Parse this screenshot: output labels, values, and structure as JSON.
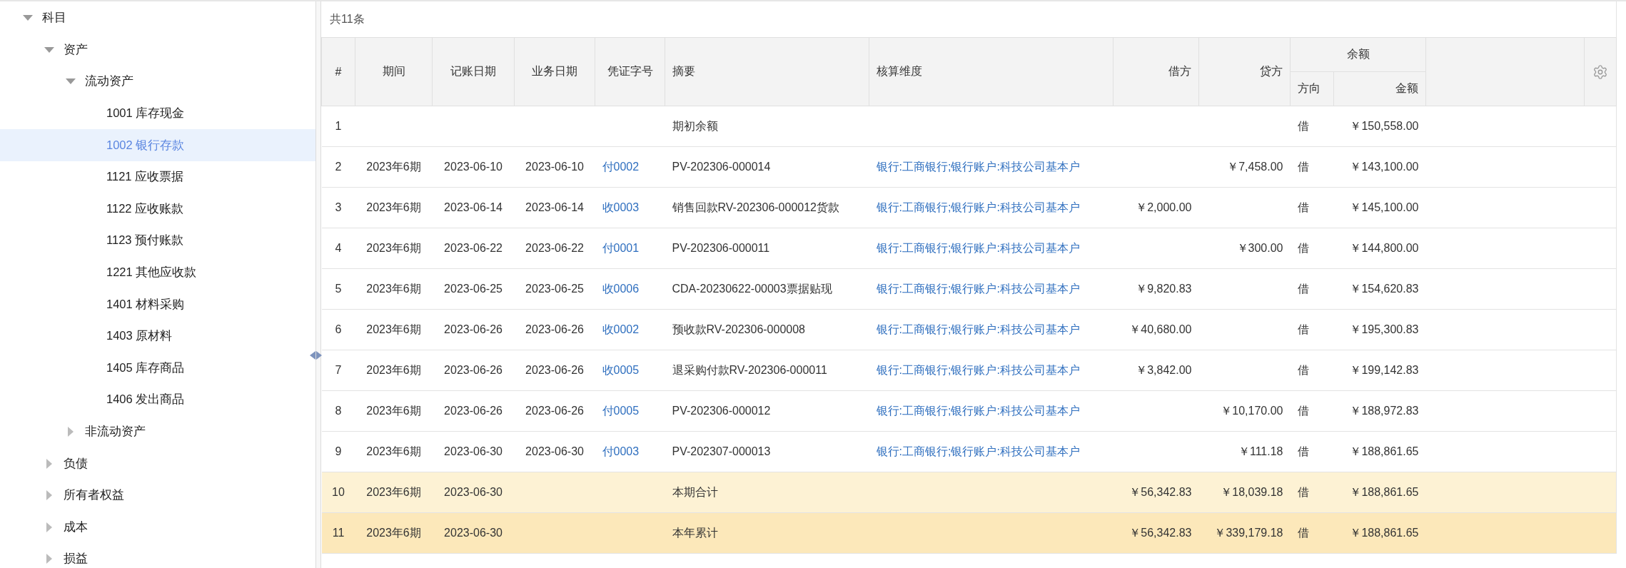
{
  "sidebar": {
    "tree": [
      {
        "label": "科目",
        "expanded": true,
        "selected": false,
        "children": [
          {
            "label": "资产",
            "expanded": true,
            "selected": false,
            "children": [
              {
                "label": "流动资产",
                "expanded": true,
                "selected": false,
                "children": [
                  {
                    "label": "1001 库存现金",
                    "selected": false
                  },
                  {
                    "label": "1002 银行存款",
                    "selected": true
                  },
                  {
                    "label": "1121 应收票据",
                    "selected": false
                  },
                  {
                    "label": "1122 应收账款",
                    "selected": false
                  },
                  {
                    "label": "1123 预付账款",
                    "selected": false
                  },
                  {
                    "label": "1221 其他应收款",
                    "selected": false
                  },
                  {
                    "label": "1401 材料采购",
                    "selected": false
                  },
                  {
                    "label": "1403 原材料",
                    "selected": false
                  },
                  {
                    "label": "1405 库存商品",
                    "selected": false
                  },
                  {
                    "label": "1406 发出商品",
                    "selected": false
                  }
                ]
              },
              {
                "label": "非流动资产",
                "expanded": false,
                "selected": false
              }
            ]
          },
          {
            "label": "负债",
            "expanded": false,
            "selected": false
          },
          {
            "label": "所有者权益",
            "expanded": false,
            "selected": false
          },
          {
            "label": "成本",
            "expanded": false,
            "selected": false
          },
          {
            "label": "损益",
            "expanded": false,
            "selected": false
          }
        ]
      }
    ]
  },
  "ledger": {
    "count_label": "共11条",
    "columns": [
      "#",
      "期间",
      "记账日期",
      "业务日期",
      "凭证字号",
      "摘要",
      "核算维度",
      "借方",
      "贷方"
    ],
    "balance_group": {
      "label": "余额",
      "columns": [
        "方向",
        "金额"
      ]
    },
    "rows": [
      {
        "kind": "normal",
        "no": "1",
        "summary": "期初余额",
        "direction": "借",
        "balance": "￥150,558.00"
      },
      {
        "kind": "normal",
        "no": "2",
        "period": "2023年6期",
        "post_date": "2023-06-10",
        "biz_date": "2023-06-10",
        "voucher": "付0002",
        "summary": "PV-202306-000014",
        "dimension": "银行:工商银行;银行账户:科技公司基本户",
        "credit": "￥7,458.00",
        "direction": "借",
        "balance": "￥143,100.00"
      },
      {
        "kind": "normal",
        "no": "3",
        "period": "2023年6期",
        "post_date": "2023-06-14",
        "biz_date": "2023-06-14",
        "voucher": "收0003",
        "summary": "销售回款RV-202306-000012货款",
        "dimension": "银行:工商银行;银行账户:科技公司基本户",
        "debit": "￥2,000.00",
        "direction": "借",
        "balance": "￥145,100.00"
      },
      {
        "kind": "normal",
        "no": "4",
        "period": "2023年6期",
        "post_date": "2023-06-22",
        "biz_date": "2023-06-22",
        "voucher": "付0001",
        "summary": "PV-202306-000011",
        "dimension": "银行:工商银行;银行账户:科技公司基本户",
        "credit": "￥300.00",
        "direction": "借",
        "balance": "￥144,800.00"
      },
      {
        "kind": "normal",
        "no": "5",
        "period": "2023年6期",
        "post_date": "2023-06-25",
        "biz_date": "2023-06-25",
        "voucher": "收0006",
        "summary": "CDA-20230622-00003票据贴现",
        "dimension": "银行:工商银行;银行账户:科技公司基本户",
        "debit": "￥9,820.83",
        "direction": "借",
        "balance": "￥154,620.83"
      },
      {
        "kind": "normal",
        "no": "6",
        "period": "2023年6期",
        "post_date": "2023-06-26",
        "biz_date": "2023-06-26",
        "voucher": "收0002",
        "summary": "预收款RV-202306-000008",
        "dimension": "银行:工商银行;银行账户:科技公司基本户",
        "debit": "￥40,680.00",
        "direction": "借",
        "balance": "￥195,300.83"
      },
      {
        "kind": "normal",
        "no": "7",
        "period": "2023年6期",
        "post_date": "2023-06-26",
        "biz_date": "2023-06-26",
        "voucher": "收0005",
        "summary": "退采购付款RV-202306-000011",
        "dimension": "银行:工商银行;银行账户:科技公司基本户",
        "debit": "￥3,842.00",
        "direction": "借",
        "balance": "￥199,142.83"
      },
      {
        "kind": "normal",
        "no": "8",
        "period": "2023年6期",
        "post_date": "2023-06-26",
        "biz_date": "2023-06-26",
        "voucher": "付0005",
        "summary": "PV-202306-000012",
        "dimension": "银行:工商银行;银行账户:科技公司基本户",
        "credit": "￥10,170.00",
        "direction": "借",
        "balance": "￥188,972.83"
      },
      {
        "kind": "normal",
        "no": "9",
        "period": "2023年6期",
        "post_date": "2023-06-30",
        "biz_date": "2023-06-30",
        "voucher": "付0003",
        "summary": "PV-202307-000013",
        "dimension": "银行:工商银行;银行账户:科技公司基本户",
        "credit": "￥111.18",
        "direction": "借",
        "balance": "￥188,861.65"
      },
      {
        "kind": "subtotal",
        "no": "10",
        "period": "2023年6期",
        "post_date": "2023-06-30",
        "summary": "本期合计",
        "debit": "￥56,342.83",
        "credit": "￥18,039.18",
        "direction": "借",
        "balance": "￥188,861.65"
      },
      {
        "kind": "total",
        "no": "11",
        "period": "2023年6期",
        "post_date": "2023-06-30",
        "summary": "本年累计",
        "debit": "￥56,342.83",
        "credit": "￥339,179.18",
        "direction": "借",
        "balance": "￥188,861.65"
      }
    ]
  }
}
